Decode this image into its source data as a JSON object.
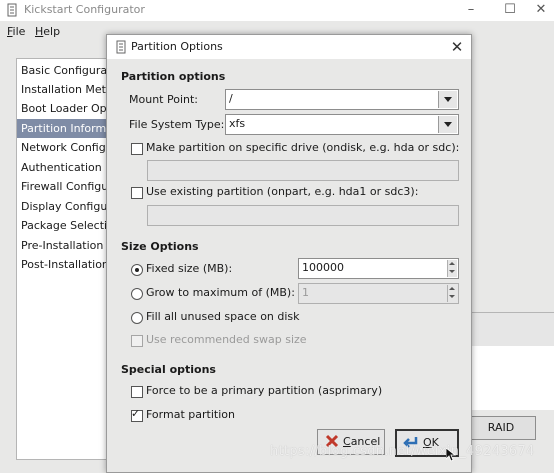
{
  "main_window": {
    "title": "Kickstart Configurator",
    "controls": {
      "minimize": "–",
      "maximize": "☐",
      "close": "✕"
    },
    "menu": {
      "file": "File",
      "file_mnemonic": "F",
      "file_rest": "ile",
      "help": "Help",
      "help_mnemonic": "H",
      "help_rest": "elp"
    },
    "sidebar": {
      "selected_index": 3,
      "items": [
        "Basic Configuration",
        "Installation Method",
        "Boot Loader Options",
        "Partition Information",
        "Network Configuration",
        "Authentication",
        "Firewall Configuration",
        "Display Configuration",
        "Package Selection",
        "Pre-Installation Script",
        "Post-Installation Script"
      ]
    },
    "raid_button": "RAID"
  },
  "dialog": {
    "title": "Partition Options",
    "close_glyph": "✕",
    "partition_options": {
      "heading": "Partition options",
      "mount_point_label": "Mount Point:",
      "mount_point_value": "/",
      "fs_type_label": "File System Type:",
      "fs_type_value": "xfs",
      "specific_drive_label": "Make partition on specific drive (ondisk, e.g. hda or sdc):",
      "specific_drive_checked": false,
      "existing_partition_label": "Use existing partition (onpart, e.g. hda1 or sdc3):",
      "existing_partition_checked": false
    },
    "size_options": {
      "heading": "Size Options",
      "fixed_size_label": "Fixed size (MB):",
      "fixed_size_value": "100000",
      "grow_label": "Grow to maximum of (MB):",
      "grow_value": "1",
      "fill_label": "Fill all unused space on disk",
      "swap_label": "Use recommended swap size",
      "selected": "fixed"
    },
    "special_options": {
      "heading": "Special options",
      "primary_label": "Force to be a primary partition (asprimary)",
      "primary_checked": false,
      "format_label": "Format partition",
      "format_checked": true
    },
    "buttons": {
      "cancel_mnemonic": "C",
      "cancel_rest": "ancel",
      "ok_mnemonic": "O",
      "ok_rest": "K"
    }
  },
  "watermark": "https://blog.csdn.net/weixin_49243674",
  "colors": {
    "selection": "#7f8ca6",
    "window_bg": "#e8e8e7",
    "cancel_icon": "#c0392b",
    "ok_icon": "#2e6fb5"
  }
}
